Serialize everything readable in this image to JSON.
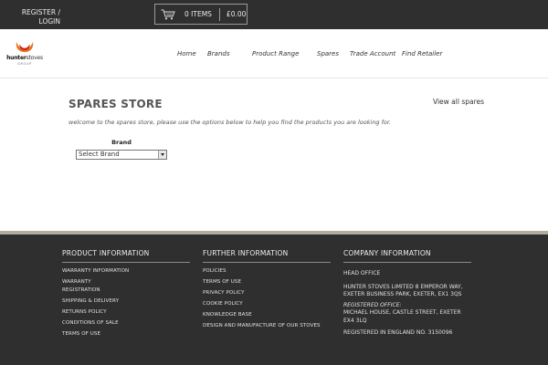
{
  "topbar": {
    "register_label": "REGISTER /",
    "login_label": "LOGIN",
    "cart_items": "0 ITEMS",
    "cart_total": "£0.00"
  },
  "logo": {
    "name_bold": "hunter",
    "name_rest": "stoves",
    "subtitle": "GROUP"
  },
  "nav": {
    "items": [
      {
        "label": "Home"
      },
      {
        "label": "Brands"
      },
      {
        "label": "Product Range"
      },
      {
        "label": "Spares"
      },
      {
        "label": "Trade Account"
      },
      {
        "label": "Find Retailer"
      }
    ]
  },
  "main": {
    "title": "SPARES STORE",
    "view_all_label": "View all spares",
    "intro": "welcome to the spares store, please use the options below to help you find the products you are looking for.",
    "brand_label": "Brand",
    "brand_select_value": "Select Brand"
  },
  "footer": {
    "product": {
      "heading": "PRODUCT INFORMATION",
      "links": [
        "WARRANTY INFORMATION",
        "WARRANTY REGISTRATION",
        "SHIPPING & DELIVERY",
        "RETURNS POLICY",
        "CONDITIONS OF SALE",
        "TERMS OF USE"
      ]
    },
    "further": {
      "heading": "FURTHER INFORMATION",
      "links": [
        "POLICIES",
        "TERMS OF USE",
        "PRIVACY POLICY",
        "COOKIE POLICY",
        "KNOWLEDGE BASE",
        "DESIGN AND MANUFACTURE OF OUR STOVES"
      ]
    },
    "company": {
      "heading": "COMPANY INFORMATION",
      "head_office": "HEAD OFFICE",
      "address": "HUNTER STOVES LIMITED 8 EMPEROR WAY, EXETER BUSINESS PARK, EXETER, EX1 3QS",
      "registered_label": "REGISTERED OFFICE:",
      "registered_address": "MICHAEL HOUSE, CASTLE STREET, EXETER EX4 3LQ",
      "registration": "REGISTERED IN ENGLAND NO. 3150096"
    }
  }
}
